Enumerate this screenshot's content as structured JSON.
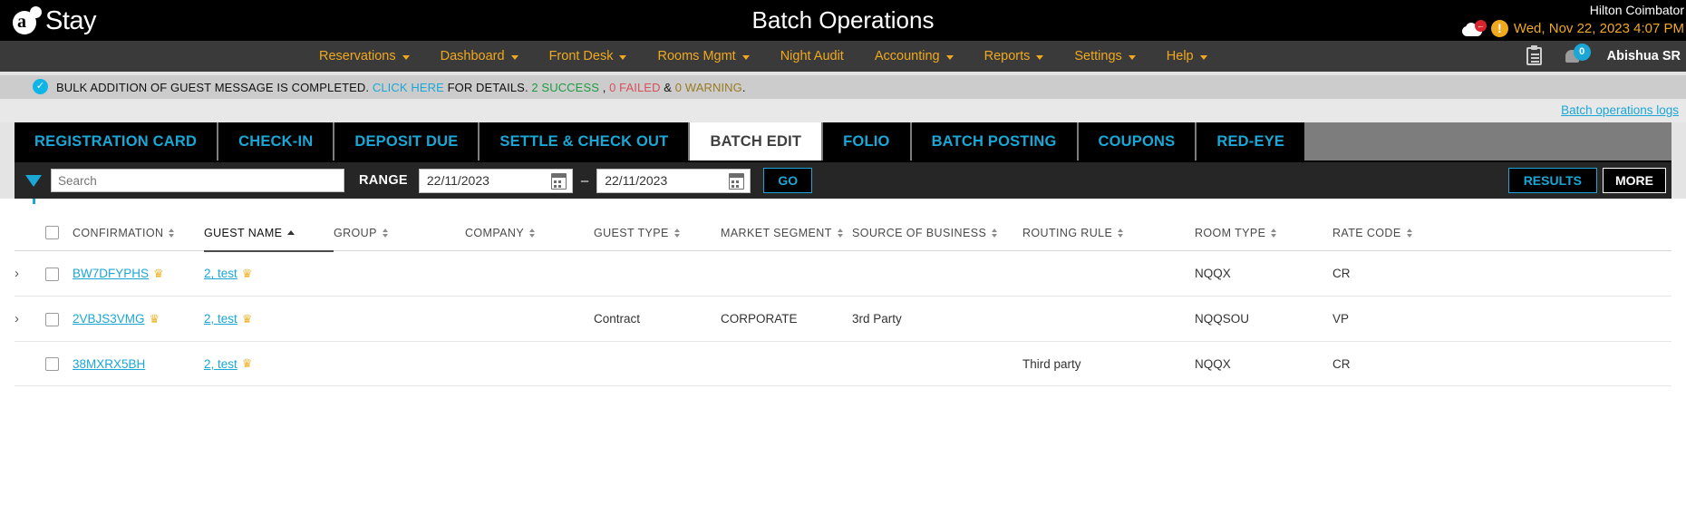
{
  "topbar": {
    "logo_letter": "a",
    "logo_text": "Stay",
    "page_title": "Batch Operations",
    "hotel_name": "Hilton Coimbator",
    "datetime": "Wed, Nov 22, 2023 4:07 PM",
    "cloud_badge": "",
    "warn_icon": "!",
    "accent_amber": "#f0a91e",
    "accent_blue": "#1ba7d6"
  },
  "nav": {
    "items": [
      {
        "label": "Reservations",
        "has_caret": true
      },
      {
        "label": "Dashboard",
        "has_caret": true
      },
      {
        "label": "Front Desk",
        "has_caret": true
      },
      {
        "label": "Rooms Mgmt",
        "has_caret": true
      },
      {
        "label": "Night Audit",
        "has_caret": false
      },
      {
        "label": "Accounting",
        "has_caret": true
      },
      {
        "label": "Reports",
        "has_caret": true
      },
      {
        "label": "Settings",
        "has_caret": true
      },
      {
        "label": "Help",
        "has_caret": true
      }
    ],
    "notification_count": "0",
    "user": "Abishua SR"
  },
  "banner": {
    "check": "✓",
    "text_1": "BULK ADDITION OF GUEST MESSAGE IS COMPLETED. ",
    "link": "CLICK HERE",
    "text_2": " FOR DETAILS. ",
    "success": "2 SUCCESS",
    "sep_1": " , ",
    "failed": "0 FAILED",
    "sep_2": " & ",
    "warning": "0 WARNING",
    "period": ".",
    "logs_link": "Batch operations logs"
  },
  "tabs": [
    {
      "label": "REGISTRATION CARD",
      "active": false
    },
    {
      "label": "CHECK-IN",
      "active": false
    },
    {
      "label": "DEPOSIT DUE",
      "active": false
    },
    {
      "label": "SETTLE & CHECK OUT",
      "active": false
    },
    {
      "label": "BATCH EDIT",
      "active": true
    },
    {
      "label": "FOLIO",
      "active": false
    },
    {
      "label": "BATCH POSTING",
      "active": false
    },
    {
      "label": "COUPONS",
      "active": false
    },
    {
      "label": "RED-EYE",
      "active": false
    }
  ],
  "toolbar": {
    "search_placeholder": "Search",
    "search_value": "",
    "range_label": "RANGE",
    "date_from": "22/11/2023",
    "date_to": "22/11/2023",
    "dash": "–",
    "go_label": "GO",
    "results_label": "RESULTS",
    "more_label": "MORE"
  },
  "table": {
    "columns": [
      {
        "label": "CONFIRMATION",
        "sortable": true,
        "sorted": false
      },
      {
        "label": "GUEST NAME",
        "sortable": true,
        "sorted": true
      },
      {
        "label": "GROUP",
        "sortable": true,
        "sorted": false
      },
      {
        "label": "COMPANY",
        "sortable": true,
        "sorted": false
      },
      {
        "label": "GUEST TYPE",
        "sortable": true,
        "sorted": false
      },
      {
        "label": "MARKET SEGMENT",
        "sortable": true,
        "sorted": false
      },
      {
        "label": "SOURCE OF BUSINESS",
        "sortable": true,
        "sorted": false
      },
      {
        "label": "ROUTING RULE",
        "sortable": true,
        "sorted": false
      },
      {
        "label": "ROOM TYPE",
        "sortable": true,
        "sorted": false
      },
      {
        "label": "RATE CODE",
        "sortable": true,
        "sorted": false
      }
    ],
    "rows": [
      {
        "expandable": true,
        "confirmation": "BW7DFYPHS",
        "confirmation_vip": true,
        "guest_name": "2, test",
        "guest_vip": true,
        "group": "",
        "company": "",
        "guest_type": "",
        "market_segment": "",
        "source_of_business": "",
        "routing_rule": "",
        "room_type": "NQQX",
        "rate_code": "CR"
      },
      {
        "expandable": true,
        "confirmation": "2VBJS3VMG",
        "confirmation_vip": true,
        "guest_name": "2, test",
        "guest_vip": true,
        "group": "",
        "company": "",
        "guest_type": "Contract",
        "market_segment": "CORPORATE",
        "source_of_business": "3rd Party",
        "routing_rule": "",
        "room_type": "NQQSOU",
        "rate_code": "VP"
      },
      {
        "expandable": false,
        "confirmation": "38MXRX5BH",
        "confirmation_vip": false,
        "guest_name": "2, test",
        "guest_vip": true,
        "group": "",
        "company": "",
        "guest_type": "",
        "market_segment": "",
        "source_of_business": "",
        "routing_rule": "Third party",
        "room_type": "NQQX",
        "rate_code": "CR"
      }
    ],
    "vip_glyph": "♛"
  }
}
